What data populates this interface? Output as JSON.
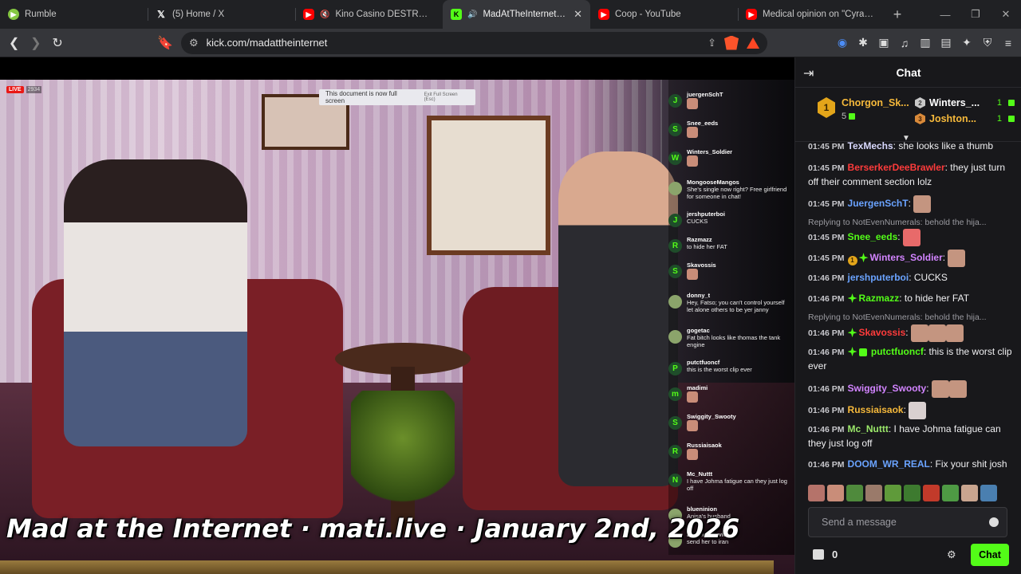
{
  "browser": {
    "tabs": [
      {
        "label": "Rumble",
        "favicon": "rumble-icon"
      },
      {
        "label": "(5) Home / X",
        "favicon": "x-icon"
      },
      {
        "label": "Kino Casino DESTROYS DSP",
        "favicon": "youtube-icon"
      },
      {
        "label": "MadAtTheInternet Stream",
        "favicon": "kick-icon",
        "active": true
      },
      {
        "label": "Coop - YouTube",
        "favicon": "youtube-icon"
      },
      {
        "label": "Medical opinion on \"Cyraxx\"'s m",
        "favicon": "youtube-icon"
      }
    ],
    "url": "kick.com/madattheinternet",
    "brave_shield_count": "4"
  },
  "video": {
    "live_label": "LIVE",
    "viewer_count": "2934",
    "fullscreen_notice": "This document is now full screen",
    "fullscreen_exit": "Exit Full Screen (Esc)",
    "caption": "Mad at the Internet · mati.live · January 2nd, 2026",
    "overlay_chat": [
      {
        "name": "juergenSchT",
        "text": "",
        "initial": "J",
        "emote": true
      },
      {
        "name": "Snee_eeds",
        "text": "",
        "initial": "S",
        "emote": true
      },
      {
        "name": "Winters_Soldier",
        "text": "",
        "initial": "W",
        "emote": true
      },
      {
        "name": "MongooseMangos",
        "text": "She's single now right? Free girlfriend for someone in chat!",
        "initial": "",
        "emote": false
      },
      {
        "name": "jershputerboi",
        "text": "CUCKS",
        "initial": "J",
        "emote": false
      },
      {
        "name": "Razmazz",
        "text": "to hide her FAT",
        "initial": "R",
        "emote": false
      },
      {
        "name": "Skavossis",
        "text": "",
        "initial": "S",
        "emote": true
      },
      {
        "name": "donny_t",
        "text": "Hey, Fatso; you can't control yourself let alone others to be yer janny",
        "initial": "",
        "emote": false
      },
      {
        "name": "gogetac",
        "text": "Fat bitch looks like thomas the tank engine",
        "initial": "",
        "emote": false
      },
      {
        "name": "putctfuoncf",
        "text": "this is the worst clip ever",
        "initial": "P",
        "emote": false
      },
      {
        "name": "madimi",
        "text": "",
        "initial": "m",
        "emote": true
      },
      {
        "name": "Swiggity_Swooty",
        "text": "",
        "initial": "S",
        "emote": true
      },
      {
        "name": "Russiaisaok",
        "text": "",
        "initial": "R",
        "emote": true
      },
      {
        "name": "Mc_Nuttt",
        "text": "I have Johma fatigue can they just log off",
        "initial": "N",
        "emote": false
      },
      {
        "name": "blueninion",
        "text": "Anisa's husband",
        "initial": "",
        "emote": false
      },
      {
        "name": "DoomedDevice",
        "text": "send her to iran",
        "initial": "",
        "emote": false
      }
    ]
  },
  "chat": {
    "title": "Chat",
    "leaderboard": {
      "first": {
        "rank": "1",
        "name": "Chorgon_Sk...",
        "count": "5"
      },
      "second": {
        "rank": "2",
        "name": "Winters_...",
        "count": "1"
      },
      "third": {
        "rank": "3",
        "name": "Joshton...",
        "count": "1"
      }
    },
    "messages": [
      {
        "time": "01:45 PM",
        "user": "TexMechs",
        "color": "#d9d9ff",
        "text": "she looks like a thumb"
      },
      {
        "time": "01:45 PM",
        "user": "BerserkerDeeBrawler",
        "color": "#ff3b3b",
        "text": "they just turn off their comment section lolz"
      },
      {
        "time": "01:45 PM",
        "user": "JuergenSchT",
        "color": "#6aa3ff",
        "text": ""
      },
      {
        "time": "01:45 PM",
        "user": "Snee_eeds",
        "color": "#53fc18",
        "text": ""
      },
      {
        "time": "01:45 PM",
        "user": "Winters_Soldier",
        "color": "#d284ff",
        "text": ""
      },
      {
        "time": "01:46 PM",
        "user": "jershputerboi",
        "color": "#6aa3ff",
        "text": "CUCKS"
      },
      {
        "time": "01:46 PM",
        "user": "Razmazz",
        "color": "#53fc18",
        "text": "to hide her FAT"
      },
      {
        "time": "01:46 PM",
        "user": "Skavossis",
        "color": "#ff3b3b",
        "text": ""
      },
      {
        "time": "01:46 PM",
        "user": "putctfuoncf",
        "color": "#53fc18",
        "text": "this is the worst clip ever"
      },
      {
        "time": "01:46 PM",
        "user": "Swiggity_Swooty",
        "color": "#d284ff",
        "text": ""
      },
      {
        "time": "01:46 PM",
        "user": "Russiaisaok",
        "color": "#f6b93b",
        "text": ""
      },
      {
        "time": "01:46 PM",
        "user": "Mc_Nuttt",
        "color": "#9be86a",
        "text": "I have Johma fatigue can they just log off"
      },
      {
        "time": "01:46 PM",
        "user": "DOOM_WR_REAL",
        "color": "#6aa3ff",
        "text": "Fix your shit josh"
      }
    ],
    "reply_1": "Replying to NotEvenNumerals: behold the hija...",
    "reply_2": "Replying to NotEvenNumerals: behold the hija...",
    "input_placeholder": "Send a message",
    "points": "0",
    "send_label": "Chat",
    "accent": "#53fc18"
  }
}
